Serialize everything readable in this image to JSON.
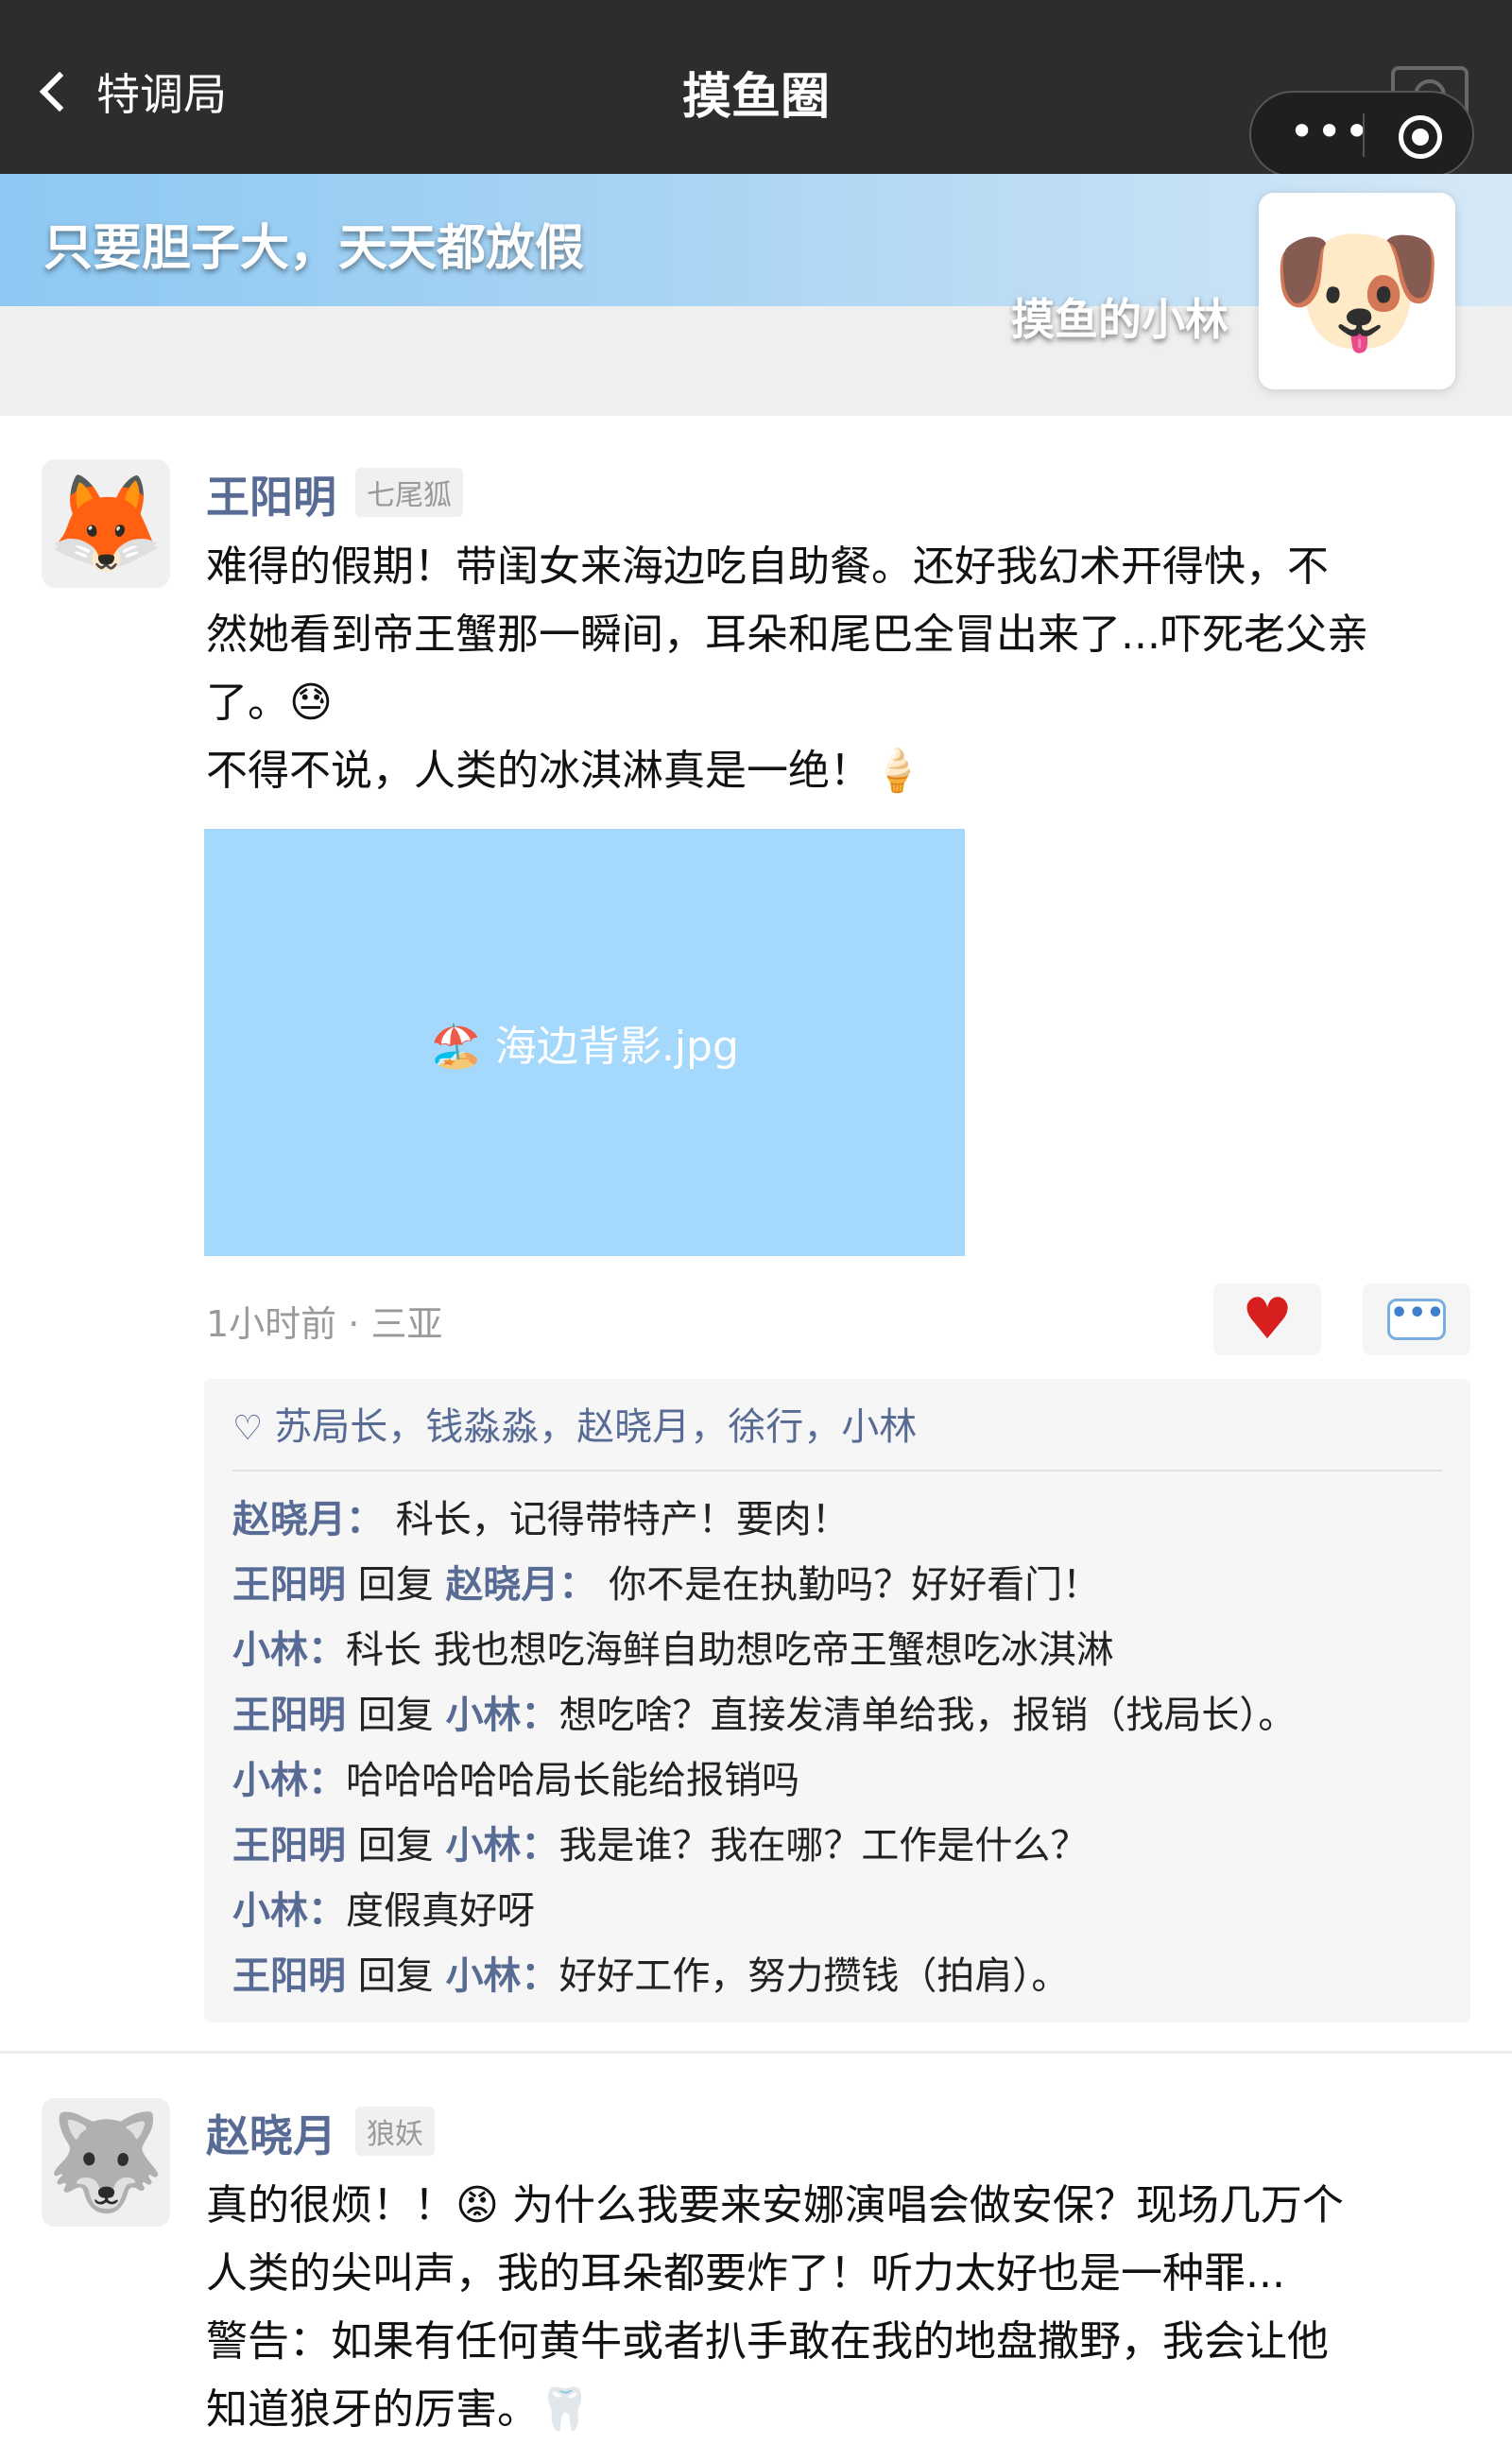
{
  "nav": {
    "back_label": "特调局",
    "title": "摸鱼圈"
  },
  "capsule": {
    "more_icon": "more-dots-icon",
    "close_icon": "target-icon"
  },
  "cover": {
    "slogan": "只要胆子大，天天都放假",
    "profile_name": "摸鱼的小林",
    "profile_avatar": "🐶"
  },
  "posts": [
    {
      "avatar": "🦊",
      "name": "王阳明",
      "tag": "七尾狐",
      "lines": [
        "难得的假期！带闺女来海边吃自助餐。还好我幻术开得快，不",
        "然她看到帝王蟹那一瞬间，耳朵和尾巴全冒出来了...吓死老父亲",
        "了。😓",
        "不得不说，人类的冰淇淋真是一绝！🍦"
      ],
      "image_label": "🏖️ 海边背影.jpg",
      "time": "1小时前",
      "location": "三亚",
      "likes_icon": "♡",
      "likes": "苏局长，钱淼淼，赵晓月，徐行，小林",
      "comments": [
        {
          "from": "赵晓月：",
          "reply_word": "",
          "to": "",
          "text": " 科长，记得带特产！要肉！"
        },
        {
          "from": "王阳明",
          "reply_word": " 回复 ",
          "to": "赵晓月：",
          "text": " 你不是在执勤吗？好好看门！"
        },
        {
          "from": "小林：",
          "reply_word": "",
          "to": "",
          "text": "科长 我也想吃海鲜自助想吃帝王蟹想吃冰淇淋"
        },
        {
          "from": "王阳明",
          "reply_word": " 回复 ",
          "to": "小林：",
          "text": "想吃啥？直接发清单给我，报销（找局长）。"
        },
        {
          "from": "小林：",
          "reply_word": "",
          "to": "",
          "text": "哈哈哈哈哈局长能给报销吗"
        },
        {
          "from": "王阳明",
          "reply_word": " 回复 ",
          "to": "小林：",
          "text": "我是谁？我在哪？工作是什么？"
        },
        {
          "from": "小林：",
          "reply_word": "",
          "to": "",
          "text": "度假真好呀"
        },
        {
          "from": "王阳明",
          "reply_word": " 回复 ",
          "to": "小林：",
          "text": "好好工作，努力攒钱（拍肩）。"
        }
      ]
    },
    {
      "avatar": "🐺",
      "name": "赵晓月",
      "tag": "狼妖",
      "lines": [
        "真的很烦！！😡 为什么我要来安娜演唱会做安保？现场几万个",
        "人类的尖叫声，我的耳朵都要炸了！听力太好也是一种罪...",
        "警告：如果有任何黄牛或者扒手敢在我的地盘撒野，我会让他",
        "知道狼牙的厉害。🦷"
      ]
    }
  ],
  "colors": {
    "topbar": "#2d2d2d",
    "name_blue": "#576b95",
    "photo_bg": "#a4d8fc",
    "heart": "#d71f1f"
  }
}
